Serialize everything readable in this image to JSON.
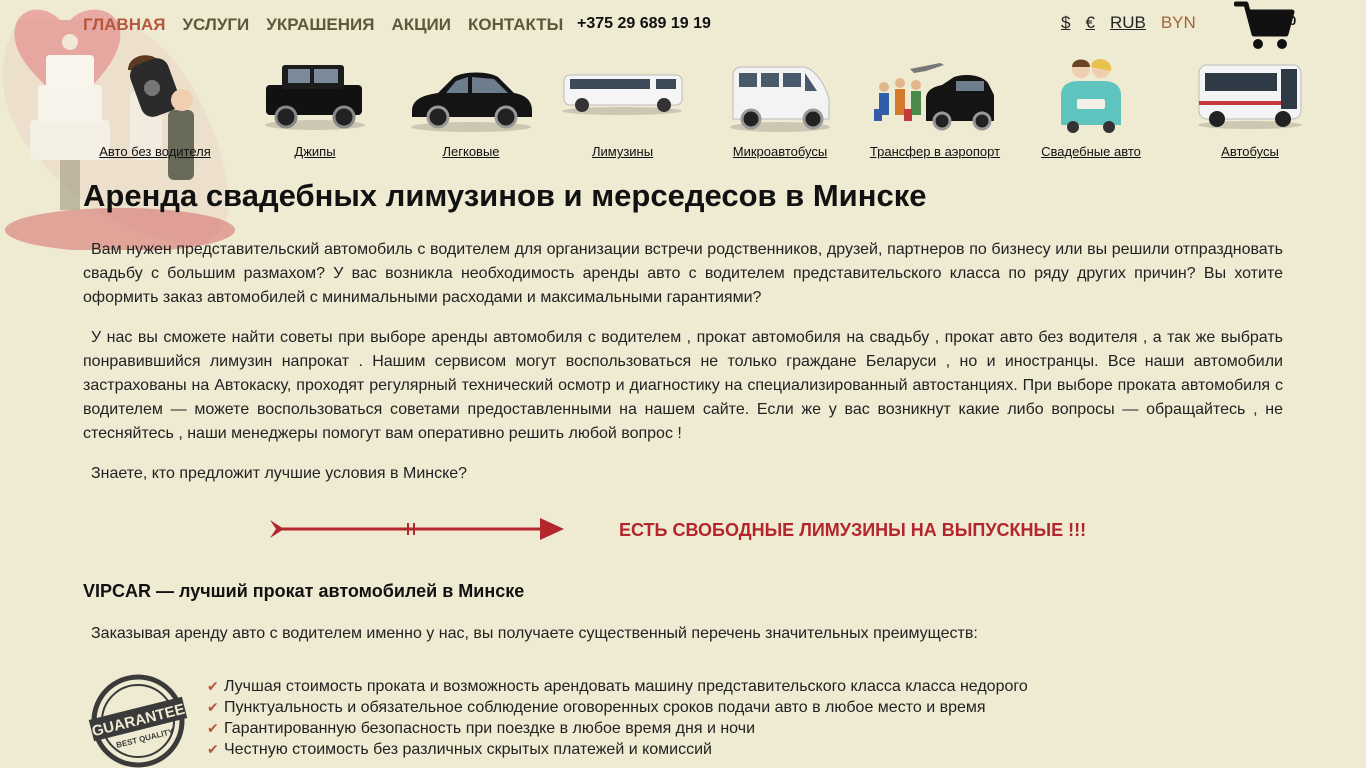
{
  "nav": {
    "items": [
      {
        "label": "Главная",
        "active": true
      },
      {
        "label": "Услуги",
        "active": false
      },
      {
        "label": "Украшения",
        "active": false
      },
      {
        "label": "Акции",
        "active": false
      },
      {
        "label": "Контакты",
        "active": false
      }
    ],
    "phone": "+375 29 689 19 19"
  },
  "currencies": [
    {
      "label": "$",
      "active": false
    },
    {
      "label": "€",
      "active": false
    },
    {
      "label": "RUB",
      "active": false
    },
    {
      "label": "BYN",
      "active": true
    }
  ],
  "cart": {
    "count": "0",
    "icon": "cart-icon"
  },
  "categories": [
    {
      "label": "Авто без водителя",
      "icon": "car-key-icon"
    },
    {
      "label": "Джипы",
      "icon": "jeep-icon"
    },
    {
      "label": "Легковые",
      "icon": "sedan-icon"
    },
    {
      "label": "Лимузины",
      "icon": "limousine-icon"
    },
    {
      "label": "Микроавтобусы",
      "icon": "minibus-icon"
    },
    {
      "label": "Трансфер в аэропорт",
      "icon": "airport-transfer-icon"
    },
    {
      "label": "Свадебные авто",
      "icon": "wedding-car-icon"
    },
    {
      "label": "Автобусы",
      "icon": "bus-icon"
    }
  ],
  "main": {
    "title": "Аренда свадебных лимузинов и мерседесов в Минске",
    "p1": "Вам нужен представительский автомобиль с водителем для организации встречи родственников, друзей, партнеров по бизнесу или вы решили отпраздновать свадьбу с большим размахом? У вас возникла необходимость аренды авто с водителем представительского класса по ряду других причин? Вы хотите оформить заказ автомобилей с минимальными расходами и максимальными гарантиями?",
    "p2": "У нас вы сможете найти советы при выборе аренды автомобиля с водителем , прокат автомобиля на свадьбу , прокат авто без водителя , а так же выбрать понравившийся лимузин напрокат . Нашим сервисом могут воспользоваться не только граждане Беларуси , но и иностранцы. Все наши автомобили застрахованы на Автокаску, проходят регулярный технический осмотр и диагностику на специализированный автостанциях. При выборе проката автомобиля с водителем — можете воспользоваться советами предоставленными на нашем сайте. Если же у вас возникнут какие либо вопросы — обращайтесь , не стесняйтесь , наши менеджеры помогут вам оперативно решить любой вопрос !",
    "p3": "Знаете, кто предложит лучшие условия в Минске?",
    "promo": "ЕСТЬ СВОБОДНЫЕ ЛИМУЗИНЫ НА ВЫПУСКНЫЕ !!!",
    "subtitle": "VIPCAR — лучший прокат автомобилей в Минске",
    "p4": "Заказывая аренду авто с водителем именно у нас, вы получаете существенный перечень значительных преимуществ:",
    "guarantee_badge": {
      "line1": "GUARANTEE",
      "line2": "BEST QUALITY"
    },
    "benefits": [
      "Лучшая стоимость проката и возможность арендовать машину представительского класса класса недорого",
      "Пунктуальность и обязательное соблюдение оговоренных сроков подачи авто в любое место и время",
      "Гарантированную безопасность при поездке в любое время дня и ночи",
      "Честную стоимость без различных скрытых платежей и комиссий"
    ]
  },
  "colors": {
    "background": "#efead2",
    "nav_active": "#b5573b",
    "nav_text": "#5b5b3a",
    "promo": "#b3262e",
    "currency_active": "#a0653a"
  }
}
